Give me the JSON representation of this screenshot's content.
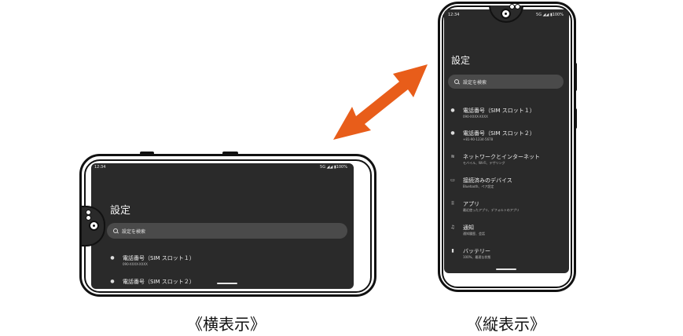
{
  "landscape": {
    "caption": "《横表示》",
    "status_time": "12:34",
    "status_right": "5G ◢◢ ▮100%",
    "title": "設定",
    "search_placeholder": "設定を検索",
    "items": [
      {
        "icon": "person-icon",
        "glyph": "●",
        "title": "電話番号（SIM スロット１）",
        "sub": "090-XXXX-XXXX"
      },
      {
        "icon": "person-icon",
        "glyph": "●",
        "title": "電話番号（SIM スロット２）",
        "sub": ""
      }
    ]
  },
  "portrait": {
    "caption": "《縦表示》",
    "status_time": "12:34",
    "status_right": "5G ◢◢ ▮100%",
    "title": "設定",
    "search_placeholder": "設定を検索",
    "items": [
      {
        "icon": "person-icon",
        "glyph": "●",
        "title": "電話番号（SIM スロット１）",
        "sub": "090-XXXX-XXXX"
      },
      {
        "icon": "person-icon",
        "glyph": "●",
        "title": "電話番号（SIM スロット２）",
        "sub": "+81-90-1234-5678"
      },
      {
        "icon": "wifi-icon",
        "glyph": "≋",
        "title": "ネットワークとインターネット",
        "sub": "モバイル、Wi-Fi、テザリング"
      },
      {
        "icon": "devices-icon",
        "glyph": "▭",
        "title": "接続済みのデバイス",
        "sub": "Bluetooth、ペア設定"
      },
      {
        "icon": "apps-icon",
        "glyph": "⠿",
        "title": "アプリ",
        "sub": "最近使ったアプリ、デフォルトのアプリ"
      },
      {
        "icon": "bell-icon",
        "glyph": "♫",
        "title": "通知",
        "sub": "通知履歴、会話"
      },
      {
        "icon": "battery-icon",
        "glyph": "▮",
        "title": "バッテリー",
        "sub": "100%、最適な状態"
      }
    ]
  },
  "arrow_color": "#e85d1a"
}
